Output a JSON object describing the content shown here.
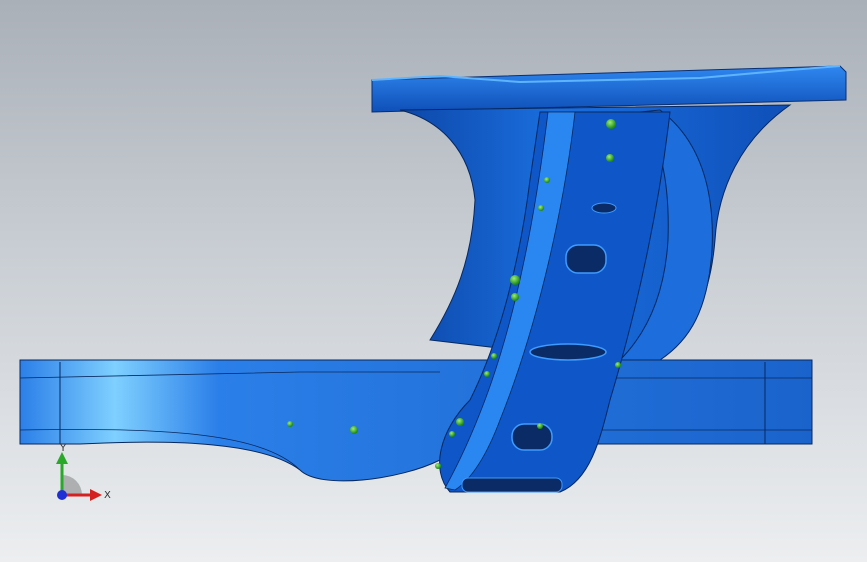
{
  "viewport": {
    "background_top": "#aab0b8",
    "background_bottom": "#eceef0"
  },
  "model": {
    "part_color": "#1a6fe0",
    "part_dark": "#0d3f96",
    "part_light": "#4fb0ff",
    "feature_color": "#3fbf2a"
  },
  "triad": {
    "x_label": "X",
    "y_label": "Y",
    "x_color": "#d42020",
    "y_color": "#2aa82a",
    "z_color": "#1f2fd6"
  }
}
